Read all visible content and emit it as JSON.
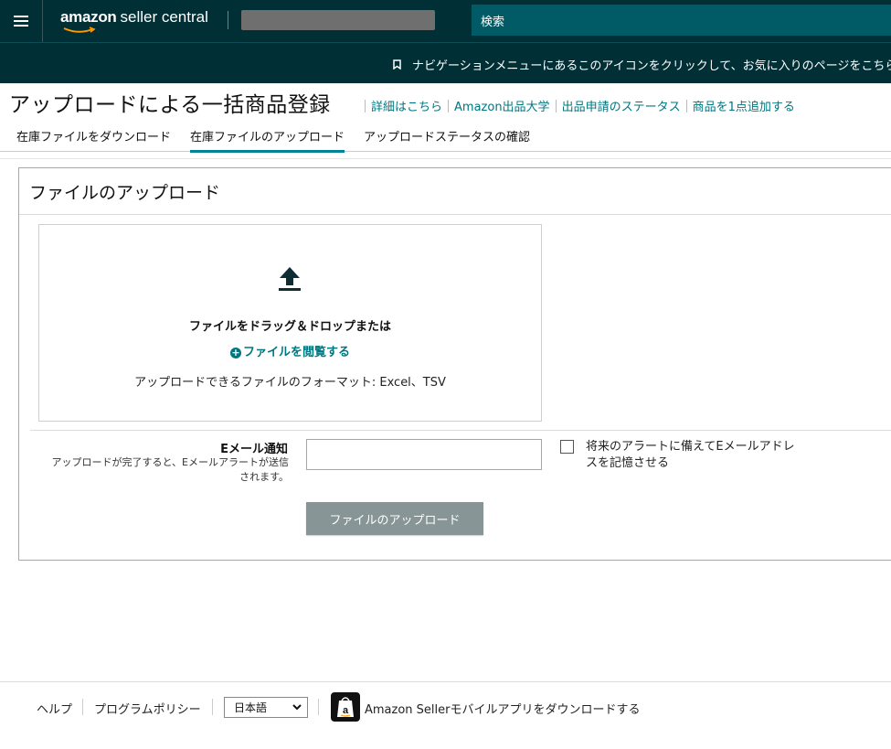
{
  "header": {
    "logo_brand": "amazon",
    "logo_product": "seller central",
    "search_placeholder": "検索"
  },
  "notice": {
    "text": "ナビゲーションメニューにあるこのアイコンをクリックして、お気に入りのページをこちらに追加",
    "icon": "bookmark-icon"
  },
  "page": {
    "title": "アップロードによる一括商品登録",
    "links": [
      "詳細はこちら",
      "Amazon出品大学",
      "出品申請のステータス",
      "商品を1点追加する"
    ]
  },
  "tabs": [
    {
      "label": "在庫ファイルをダウンロード",
      "active": false
    },
    {
      "label": "在庫ファイルのアップロード",
      "active": true
    },
    {
      "label": "アップロードステータスの確認",
      "active": false
    }
  ],
  "upload": {
    "title": "ファイルのアップロード",
    "drag_text": "ファイルをドラッグ＆ドロップまたは",
    "browse_text": "ファイルを閲覧する",
    "format_text": "アップロードできるファイルのフォーマット: Excel、TSV",
    "email_label": "Eメール通知",
    "email_help": "アップロードが完了すると、Eメールアラートが送信されます。",
    "email_value": "",
    "remember_label": "将来のアラートに備えてEメールアドレスを記憶させる",
    "button_label": "ファイルのアップロード"
  },
  "footer": {
    "help": "ヘルプ",
    "policy": "プログラムポリシー",
    "language": "日本語",
    "app_text": "Amazon Sellerモバイルアプリをダウンロードする"
  },
  "colors": {
    "header_bg": "#002f36",
    "search_bg": "#005b66",
    "accent": "#00777f",
    "button_disabled": "#879596"
  }
}
